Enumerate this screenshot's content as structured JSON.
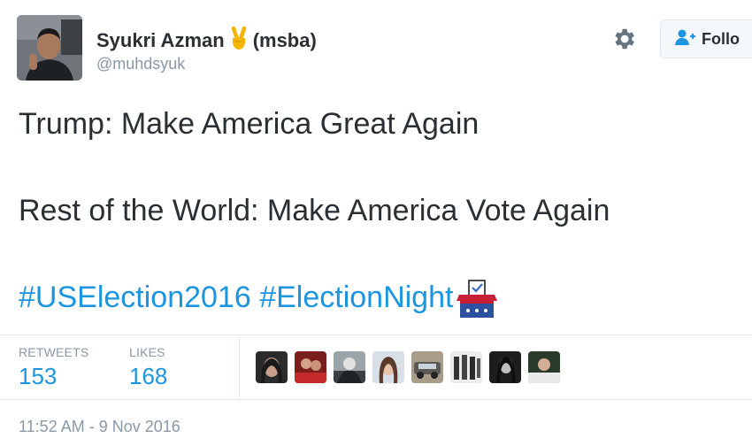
{
  "user": {
    "display_name": "Syukri Azman",
    "display_suffix": "(msba)",
    "handle": "@muhdsyuk"
  },
  "actions": {
    "follow_label": "Follo"
  },
  "tweet": {
    "line1": "Trump: Make America Great Again",
    "line2": "Rest of the World: Make America Vote Again",
    "hashtags": [
      "#USElection2016",
      "#ElectionNight"
    ]
  },
  "stats": {
    "retweets_label": "RETWEETS",
    "retweets_count": "153",
    "likes_label": "LIKES",
    "likes_count": "168"
  },
  "timestamp": "11:52 AM - 9 Nov 2016",
  "colors": {
    "link": "#1b95e0",
    "text": "#292f33",
    "muted": "#8899a6"
  },
  "icons": [
    "victory-hand-emoji",
    "gear-icon",
    "follow-person-icon",
    "ballot-box-emoji"
  ]
}
